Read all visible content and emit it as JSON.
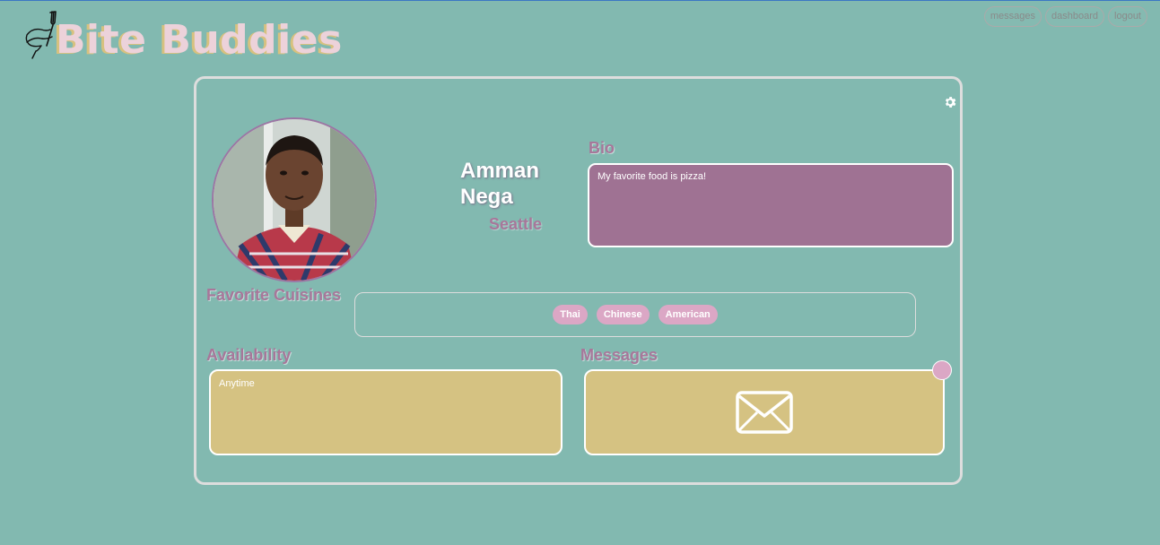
{
  "brand": {
    "name": "Bite Buddies",
    "icon": "hand-fork-icon"
  },
  "nav": {
    "messages": "messages",
    "dashboard": "dashboard",
    "logout": "logout"
  },
  "profile": {
    "name": "Amman Nega",
    "city": "Seattle",
    "photo_alt": "profile photo",
    "settings_icon": "gear-icon"
  },
  "bio": {
    "heading": "Bio",
    "text": "My favorite food is pizza!"
  },
  "cuisines": {
    "heading": "Favorite Cuisines",
    "items": [
      "Thai",
      "Chinese",
      "American"
    ]
  },
  "availability": {
    "heading": "Availability",
    "text": "Anytime"
  },
  "messages": {
    "heading": "Messages",
    "icon": "envelope-icon"
  },
  "colors": {
    "background": "#82b9b0",
    "accent_pink": "#dba7c5",
    "bio_purple": "#9f7293",
    "heading_mauve": "#a7779a",
    "box_gold": "#d5c282"
  }
}
